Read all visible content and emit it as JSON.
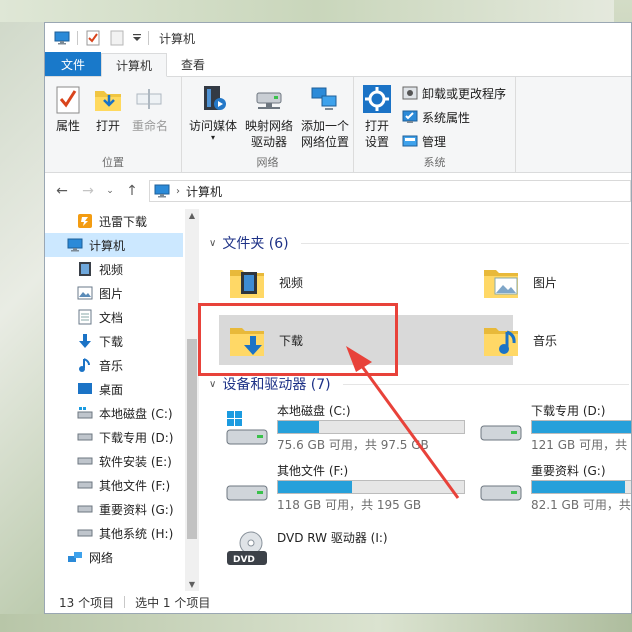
{
  "window": {
    "title": "计算机"
  },
  "tabs": [
    {
      "label": "文件",
      "kind": "file"
    },
    {
      "label": "计算机",
      "kind": "active"
    },
    {
      "label": "查看",
      "kind": "normal"
    }
  ],
  "ribbon": {
    "groups": [
      {
        "label": "位置",
        "buttons": [
          {
            "label": "属性",
            "icon": "properties-icon"
          },
          {
            "label": "打开",
            "icon": "open-folder-icon"
          },
          {
            "label": "重命名",
            "icon": "rename-icon",
            "disabled": true
          }
        ]
      },
      {
        "label": "网络",
        "buttons": [
          {
            "label": "访问媒体",
            "icon": "media-icon",
            "dropdown": true
          },
          {
            "label": "映射网络\n驱动器",
            "icon": "map-drive-icon",
            "dropdown": true
          },
          {
            "label": "添加一个\n网络位置",
            "icon": "network-location-icon"
          }
        ]
      },
      {
        "label": "系统",
        "big": {
          "label": "打开\n设置",
          "icon": "settings-gear-icon"
        },
        "small": [
          {
            "label": "卸载或更改程序",
            "icon": "uninstall-icon"
          },
          {
            "label": "系统属性",
            "icon": "system-properties-icon"
          },
          {
            "label": "管理",
            "icon": "manage-icon"
          }
        ]
      }
    ]
  },
  "address": {
    "crumb": "计算机"
  },
  "nav": {
    "items": [
      {
        "label": "迅雷下载",
        "icon": "xunlei-folder-icon",
        "indent": 1
      },
      {
        "label": "计算机",
        "icon": "computer-icon",
        "indent": 0,
        "selected": true
      },
      {
        "label": "视频",
        "icon": "video-icon",
        "indent": 1
      },
      {
        "label": "图片",
        "icon": "pictures-icon",
        "indent": 1
      },
      {
        "label": "文档",
        "icon": "documents-icon",
        "indent": 1
      },
      {
        "label": "下载",
        "icon": "download-arrow-icon",
        "indent": 1
      },
      {
        "label": "音乐",
        "icon": "music-icon",
        "indent": 1
      },
      {
        "label": "桌面",
        "icon": "desktop-icon",
        "indent": 1
      },
      {
        "label": "本地磁盘 (C:)",
        "icon": "windows-drive-icon",
        "indent": 1
      },
      {
        "label": "下载专用 (D:)",
        "icon": "drive-icon",
        "indent": 1
      },
      {
        "label": "软件安装 (E:)",
        "icon": "drive-icon",
        "indent": 1
      },
      {
        "label": "其他文件 (F:)",
        "icon": "drive-icon",
        "indent": 1
      },
      {
        "label": "重要资料 (G:)",
        "icon": "drive-icon",
        "indent": 1
      },
      {
        "label": "其他系统 (H:)",
        "icon": "drive-icon",
        "indent": 1
      },
      {
        "label": "网络",
        "icon": "network-icon",
        "indent": 0
      }
    ]
  },
  "folders": {
    "header": "文件夹 (6)",
    "items": [
      {
        "label": "视频",
        "icon": "video-folder-icon"
      },
      {
        "label": "图片",
        "icon": "pictures-folder-icon"
      },
      {
        "label": "下载",
        "icon": "downloads-folder-icon",
        "highlighted": true
      },
      {
        "label": "音乐",
        "icon": "music-folder-icon"
      }
    ]
  },
  "drives": {
    "header": "设备和驱动器 (7)",
    "items": [
      {
        "label": "本地磁盘 (C:)",
        "size": "75.6 GB 可用，共 97.5 GB",
        "used_fraction": 0.22,
        "icon": "windows-drive-icon"
      },
      {
        "label": "下载专用 (D:)",
        "size": "121 GB 可用，共",
        "used_fraction": 0.62,
        "icon": "drive-icon"
      },
      {
        "label": "其他文件 (F:)",
        "size": "118 GB 可用，共 195 GB",
        "used_fraction": 0.4,
        "icon": "drive-icon"
      },
      {
        "label": "重要资料 (G:)",
        "size": "82.1 GB 可用，共",
        "used_fraction": 0.5,
        "icon": "drive-icon"
      },
      {
        "label": "DVD RW 驱动器 (I:)",
        "icon": "dvd-drive-icon"
      }
    ]
  },
  "status": {
    "count": "13 个项目",
    "selection": "选中 1 个项目"
  },
  "colors": {
    "accent": "#1979ca",
    "selection": "#cce8ff",
    "bar_fill": "#26a0da",
    "annotation": "#e8423a"
  }
}
